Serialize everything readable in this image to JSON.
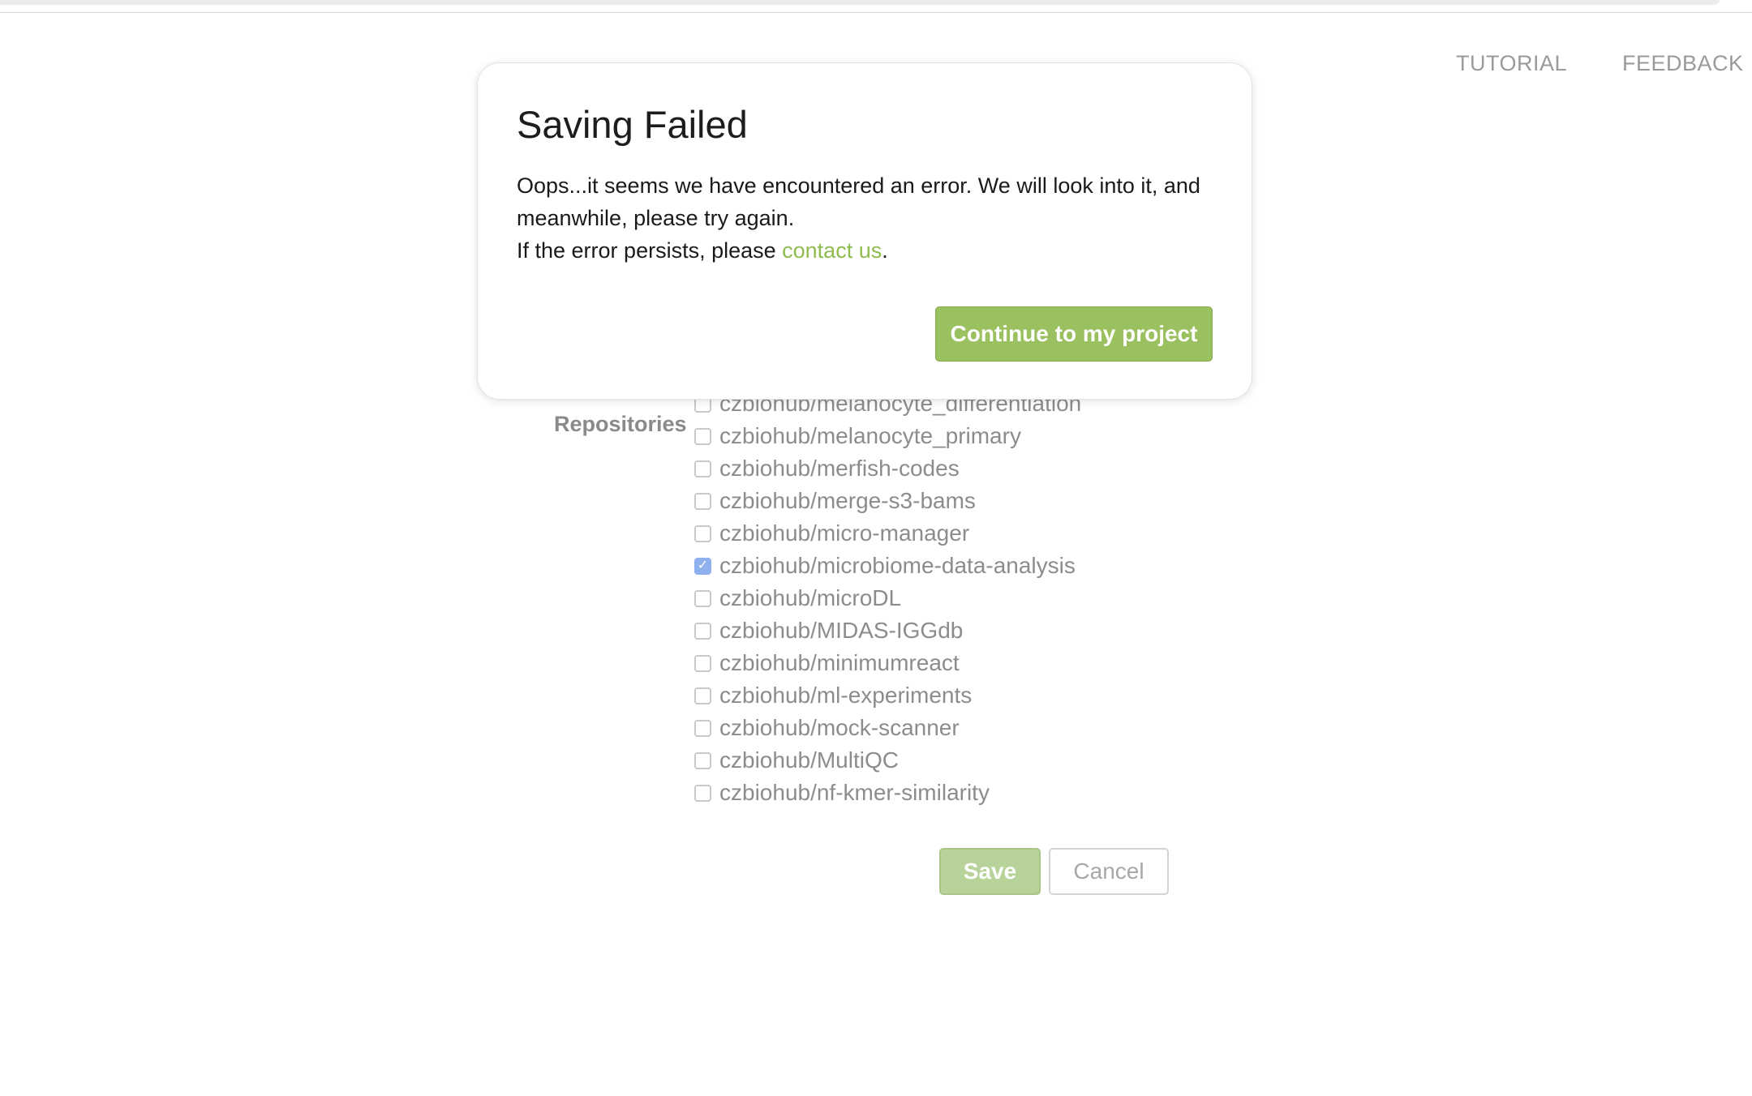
{
  "header": {
    "nav": [
      {
        "label": "TUTORIAL"
      },
      {
        "label": "FEEDBACK"
      }
    ]
  },
  "form": {
    "repositories_label": "Repositories",
    "repositories": [
      {
        "name": "czbiohub/melanocyte_differentiation",
        "checked": false
      },
      {
        "name": "czbiohub/melanocyte_primary",
        "checked": false
      },
      {
        "name": "czbiohub/merfish-codes",
        "checked": false
      },
      {
        "name": "czbiohub/merge-s3-bams",
        "checked": false
      },
      {
        "name": "czbiohub/micro-manager",
        "checked": false
      },
      {
        "name": "czbiohub/microbiome-data-analysis",
        "checked": true
      },
      {
        "name": "czbiohub/microDL",
        "checked": false
      },
      {
        "name": "czbiohub/MIDAS-IGGdb",
        "checked": false
      },
      {
        "name": "czbiohub/minimumreact",
        "checked": false
      },
      {
        "name": "czbiohub/ml-experiments",
        "checked": false
      },
      {
        "name": "czbiohub/mock-scanner",
        "checked": false
      },
      {
        "name": "czbiohub/MultiQC",
        "checked": false
      },
      {
        "name": "czbiohub/nf-kmer-similarity",
        "checked": false
      }
    ],
    "save_label": "Save",
    "cancel_label": "Cancel"
  },
  "modal": {
    "title": "Saving Failed",
    "line1": "Oops...it seems we have encountered an error. We will look into it, and meanwhile, please try again.",
    "line2_prefix": "If the error persists, please ",
    "contact_link": "contact us",
    "line2_suffix": ".",
    "continue_label": "Continue to my project"
  },
  "colors": {
    "accent_green": "#9ac05f",
    "link_green": "#8fbb4f",
    "checkbox_checked": "#8fb2ee"
  }
}
